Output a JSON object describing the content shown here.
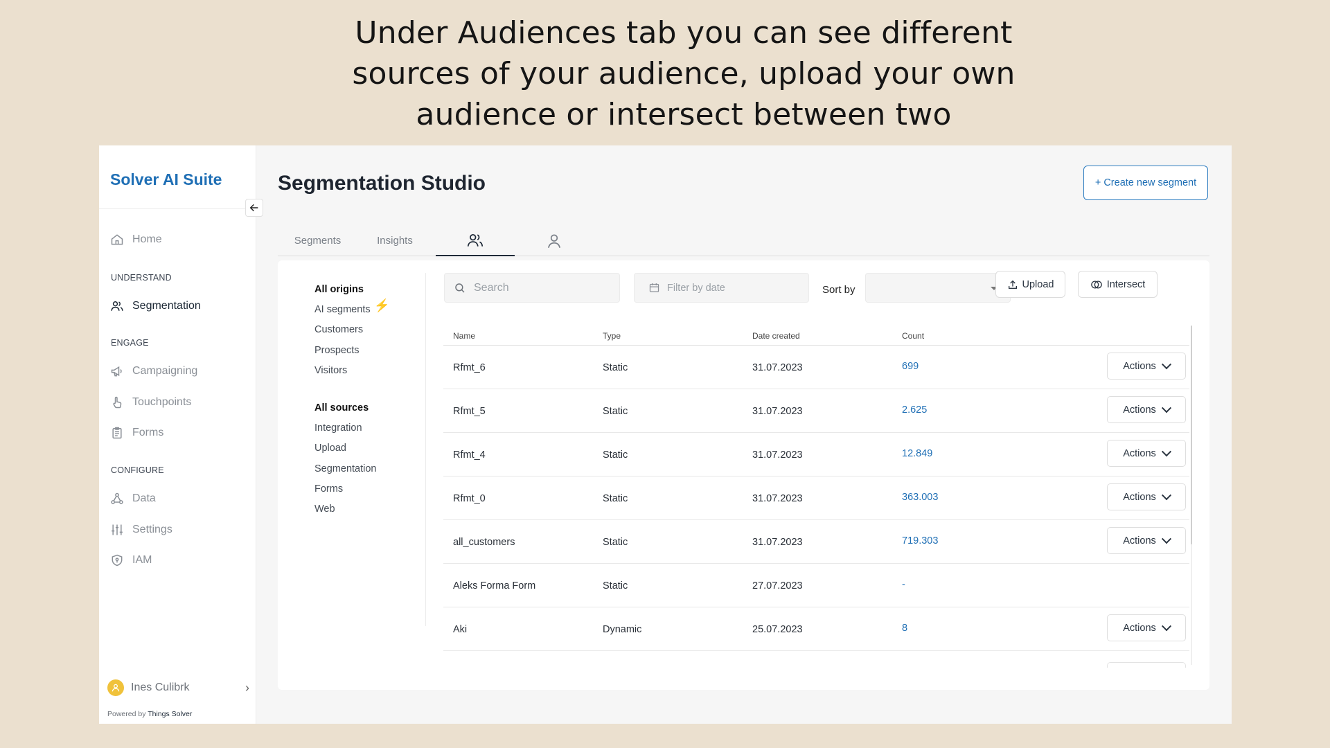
{
  "caption": {
    "line1": "Under Audiences tab you can see different",
    "line2": "sources of your audience, upload your own",
    "line3": "audience or intersect between two"
  },
  "sidebar": {
    "brand": "Solver AI Suite",
    "sections": {
      "understand": "UNDERSTAND",
      "engage": "ENGAGE",
      "configure": "CONFIGURE"
    },
    "items": {
      "home": "Home",
      "segmentation": "Segmentation",
      "campaigning": "Campaigning",
      "touchpoints": "Touchpoints",
      "forms": "Forms",
      "data": "Data",
      "settings": "Settings",
      "iam": "IAM"
    },
    "user": "Ines Culibrk",
    "powered_prefix": "Powered by",
    "powered_brand": "Things Solver"
  },
  "main": {
    "title": "Segmentation Studio",
    "create_button": "+ Create new segment",
    "tabs": {
      "segments": "Segments",
      "insights": "Insights",
      "audiences_icon": "users-icon",
      "profile_icon": "user-icon"
    },
    "filters": {
      "origins": [
        "All origins",
        "AI segments",
        "Customers",
        "Prospects",
        "Visitors"
      ],
      "sources": [
        "All sources",
        "Integration",
        "Upload",
        "Segmentation",
        "Forms",
        "Web"
      ]
    },
    "toolbar": {
      "search_placeholder": "Search",
      "date_placeholder": "Filter by date",
      "sort_label": "Sort by",
      "sort_value": "",
      "upload": "Upload",
      "intersect": "Intersect"
    },
    "table": {
      "headers": {
        "name": "Name",
        "type": "Type",
        "date": "Date created",
        "count": "Count"
      },
      "actions_label": "Actions",
      "rows": [
        {
          "name": "Rfmt_6",
          "type": "Static",
          "date": "31.07.2023",
          "count": "699"
        },
        {
          "name": "Rfmt_5",
          "type": "Static",
          "date": "31.07.2023",
          "count": "2.625"
        },
        {
          "name": "Rfmt_4",
          "type": "Static",
          "date": "31.07.2023",
          "count": "12.849"
        },
        {
          "name": "Rfmt_0",
          "type": "Static",
          "date": "31.07.2023",
          "count": "363.003"
        },
        {
          "name": "all_customers",
          "type": "Static",
          "date": "31.07.2023",
          "count": "719.303"
        },
        {
          "name": "Aleks Forma Form",
          "type": "Static",
          "date": "27.07.2023",
          "count": "-"
        },
        {
          "name": "Aki",
          "type": "Dynamic",
          "date": "25.07.2023",
          "count": "8"
        }
      ]
    }
  },
  "colors": {
    "background": "#ebe0cf",
    "brand": "#1f6fb5",
    "accent_bolt": "#f2b31e",
    "avatar": "#f0c23b"
  }
}
